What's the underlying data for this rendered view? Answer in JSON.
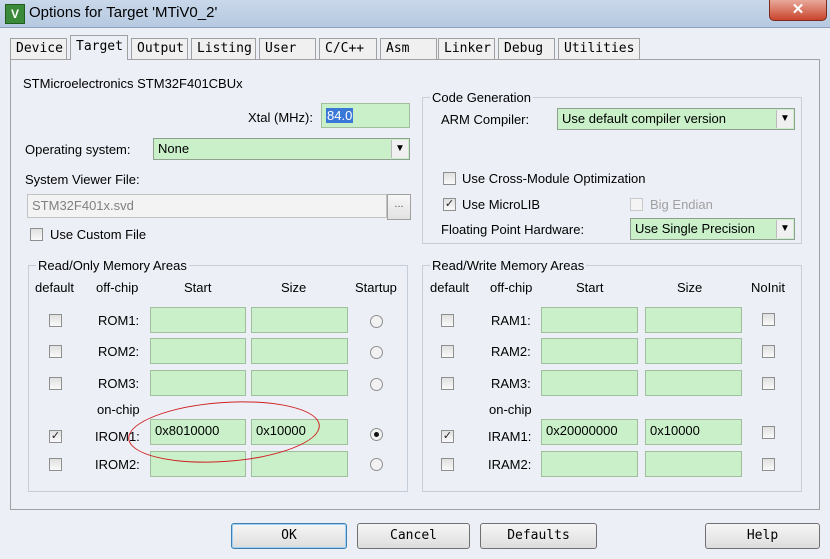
{
  "window": {
    "title": "Options for Target 'MTiV0_2'",
    "app_icon": "V",
    "close_glyph": "✕"
  },
  "tabs": [
    "Device",
    "Target",
    "Output",
    "Listing",
    "User",
    "C/C++",
    "Asm",
    "Linker",
    "Debug",
    "Utilities"
  ],
  "active_tab": "Target",
  "device": "STMicroelectronics STM32F401CBUx",
  "xtal": {
    "label": "Xtal (MHz):",
    "value": "84.0"
  },
  "os": {
    "label": "Operating system:",
    "value": "None"
  },
  "svd": {
    "label": "System Viewer File:",
    "value": "STM32F401x.svd",
    "browse": "..."
  },
  "custom_file": {
    "label": "Use Custom File",
    "checked": false
  },
  "code_gen": {
    "title": "Code Generation",
    "compiler_label": "ARM Compiler:",
    "compiler_value": "Use default compiler version",
    "cross_module": {
      "label": "Use Cross-Module Optimization",
      "checked": false
    },
    "microlib": {
      "label": "Use MicroLIB",
      "checked": true
    },
    "big_endian": {
      "label": "Big Endian",
      "checked": false
    },
    "fpu_label": "Floating Point Hardware:",
    "fpu_value": "Use Single Precision"
  },
  "ro_memory": {
    "title": "Read/Only Memory Areas",
    "headers": {
      "default": "default",
      "offchip": "off-chip",
      "start": "Start",
      "size": "Size",
      "startup": "Startup"
    },
    "onchip_label": "on-chip",
    "rows": [
      {
        "name": "ROM1:",
        "default": false,
        "start": "",
        "size": "",
        "startup": false
      },
      {
        "name": "ROM2:",
        "default": false,
        "start": "",
        "size": "",
        "startup": false
      },
      {
        "name": "ROM3:",
        "default": false,
        "start": "",
        "size": "",
        "startup": false
      },
      {
        "name": "IROM1:",
        "default": true,
        "start": "0x8010000",
        "size": "0x10000",
        "startup": true
      },
      {
        "name": "IROM2:",
        "default": false,
        "start": "",
        "size": "",
        "startup": false
      }
    ]
  },
  "rw_memory": {
    "title": "Read/Write Memory Areas",
    "headers": {
      "default": "default",
      "offchip": "off-chip",
      "start": "Start",
      "size": "Size",
      "noinit": "NoInit"
    },
    "onchip_label": "on-chip",
    "rows": [
      {
        "name": "RAM1:",
        "default": false,
        "start": "",
        "size": "",
        "noinit": false
      },
      {
        "name": "RAM2:",
        "default": false,
        "start": "",
        "size": "",
        "noinit": false
      },
      {
        "name": "RAM3:",
        "default": false,
        "start": "",
        "size": "",
        "noinit": false
      },
      {
        "name": "IRAM1:",
        "default": true,
        "start": "0x20000000",
        "size": "0x10000",
        "noinit": false
      },
      {
        "name": "IRAM2:",
        "default": false,
        "start": "",
        "size": "",
        "noinit": false
      }
    ]
  },
  "buttons": {
    "ok": "OK",
    "cancel": "Cancel",
    "defaults": "Defaults",
    "help": "Help"
  },
  "colors": {
    "field_bg": "#c9f0c9",
    "annotation": "#d02020",
    "selection": "#3a78d8"
  }
}
